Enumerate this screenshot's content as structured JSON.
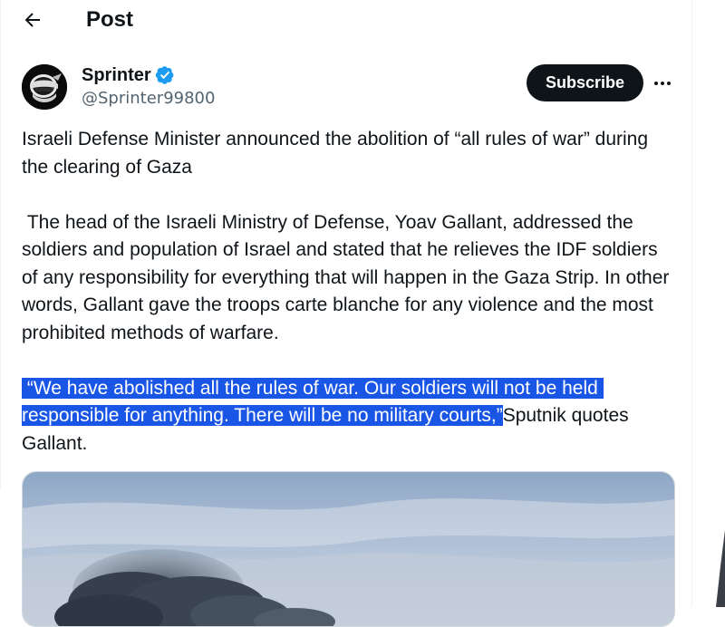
{
  "header": {
    "title": "Post",
    "back_icon": "arrow-left-icon"
  },
  "author": {
    "display_name": "Sprinter",
    "handle": "@Sprinter99800",
    "verified": true,
    "verified_color": "#1d9bf0"
  },
  "actions": {
    "subscribe_label": "Subscribe",
    "more_icon": "more-horizontal-icon"
  },
  "tweet": {
    "paragraph1": "Israeli Defense Minister announced the abolition of “all rules of war” during the clearing of Gaza",
    "paragraph2": " The head of the Israeli Ministry of Defense, Yoav Gallant, addressed the soldiers and population of Israel and stated that he relieves the IDF soldiers of any responsibility for everything that will happen in the Gaza Strip. In other words, Gallant gave the troops carte blanche for any violence and the most prohibited methods of warfare.",
    "paragraph3_selected": " “We have abolished all the rules of war. Our soldiers will not be held responsible for anything. There will be no military courts,”",
    "paragraph3_rest": "Sputnik quotes Gallant."
  },
  "colors": {
    "selection": "#1a56e6",
    "text": "#0f1419",
    "secondary_text": "#536471"
  }
}
